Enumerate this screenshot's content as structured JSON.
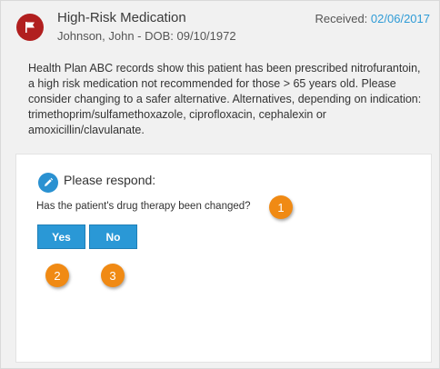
{
  "alert": {
    "title": "High-Risk Medication",
    "patient": "Johnson, John - DOB: 09/10/1972",
    "received_label": "Received:",
    "received_date": "02/06/2017",
    "message": "Health Plan ABC records show this patient has been prescribed nitrofurantoin, a high risk medication not recommended for those > 65 years old. Please consider changing to a safer alternative. Alternatives, depending on indication: trimethoprim/sulfamethoxazole, ciprofloxacin, cephalexin or amoxicillin/clavulanate.",
    "flag_icon": "flag-icon"
  },
  "response": {
    "heading": "Please respond:",
    "pencil_icon": "pencil-icon",
    "question": "Has the patient's drug therapy been changed?",
    "yes_label": "Yes",
    "no_label": "No"
  },
  "callouts": {
    "one": "1",
    "two": "2",
    "three": "3"
  },
  "colors": {
    "flag_badge": "#b11f1f",
    "accent_blue": "#2a98d6",
    "callout_orange": "#f08a14"
  }
}
